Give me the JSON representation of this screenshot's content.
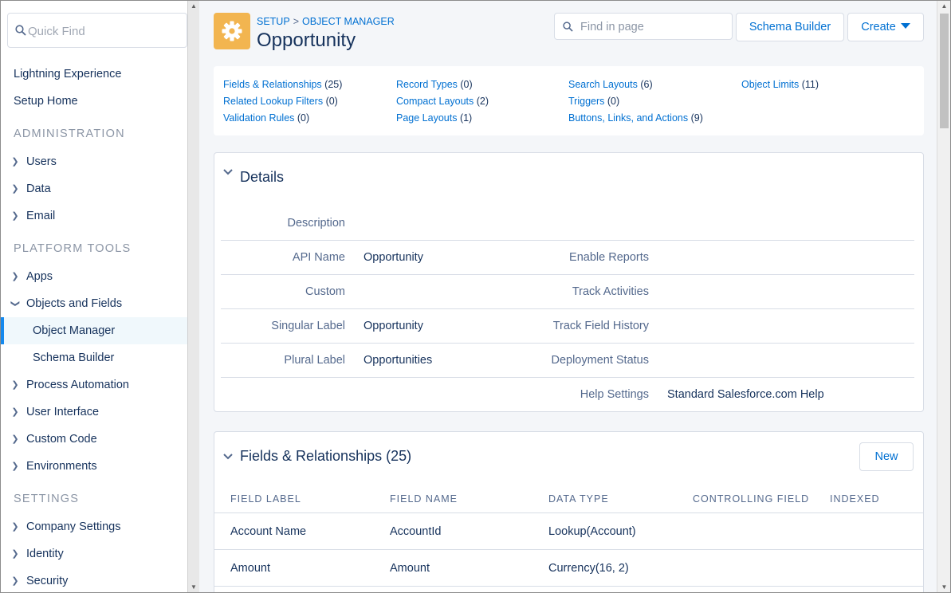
{
  "sidebar": {
    "quick_find_placeholder": "Quick Find",
    "top_items": [
      "Lightning Experience",
      "Setup Home"
    ],
    "administration_header": "ADMINISTRATION",
    "administration_items": [
      "Users",
      "Data",
      "Email"
    ],
    "platform_tools_header": "PLATFORM TOOLS",
    "platform_items": {
      "apps": "Apps",
      "objects_and_fields": "Objects and Fields",
      "object_manager": "Object Manager",
      "schema_builder": "Schema Builder",
      "process_automation": "Process Automation",
      "user_interface": "User Interface",
      "custom_code": "Custom Code",
      "environments": "Environments"
    },
    "settings_header": "SETTINGS",
    "settings_items": [
      "Company Settings",
      "Identity",
      "Security"
    ]
  },
  "header": {
    "breadcrumb_setup": "SETUP",
    "breadcrumb_sep": ">",
    "breadcrumb_object_manager": "OBJECT MANAGER",
    "title": "Opportunity",
    "find_placeholder": "Find in page",
    "schema_builder_label": "Schema Builder",
    "create_label": "Create"
  },
  "quick_links": [
    {
      "label": "Fields & Relationships",
      "count": "(25)"
    },
    {
      "label": "Related Lookup Filters",
      "count": "(0)"
    },
    {
      "label": "Validation Rules",
      "count": "(0)"
    },
    {
      "label": "Record Types",
      "count": "(0)"
    },
    {
      "label": "Compact Layouts",
      "count": "(2)"
    },
    {
      "label": "Page Layouts",
      "count": "(1)"
    },
    {
      "label": "Search Layouts",
      "count": "(6)"
    },
    {
      "label": "Triggers",
      "count": "(0)"
    },
    {
      "label": "Buttons, Links, and Actions",
      "count": "(9)"
    },
    {
      "label": "Object Limits",
      "count": "(11)"
    }
  ],
  "details": {
    "title": "Details",
    "description_label": "Description",
    "description_value": "",
    "api_name_label": "API Name",
    "api_name_value": "Opportunity",
    "custom_label": "Custom",
    "singular_label_label": "Singular Label",
    "singular_label_value": "Opportunity",
    "plural_label_label": "Plural Label",
    "plural_label_value": "Opportunities",
    "enable_reports_label": "Enable Reports",
    "track_activities_label": "Track Activities",
    "track_field_history_label": "Track Field History",
    "deployment_status_label": "Deployment Status",
    "help_settings_label": "Help Settings",
    "help_settings_value": "Standard Salesforce.com Help"
  },
  "fields": {
    "title": "Fields & Relationships (25)",
    "new_label": "New",
    "columns": [
      "FIELD LABEL",
      "FIELD NAME",
      "DATA TYPE",
      "CONTROLLING FIELD",
      "INDEXED"
    ],
    "rows": [
      {
        "label": "Account Name",
        "name": "AccountId",
        "type": "Lookup(Account)"
      },
      {
        "label": "Amount",
        "name": "Amount",
        "type": "Currency(16, 2)"
      }
    ]
  },
  "colors": {
    "brand_link": "#0070d2",
    "text": "#16325c",
    "object_icon": "#f2b550",
    "active_nav": "#1589ee"
  }
}
